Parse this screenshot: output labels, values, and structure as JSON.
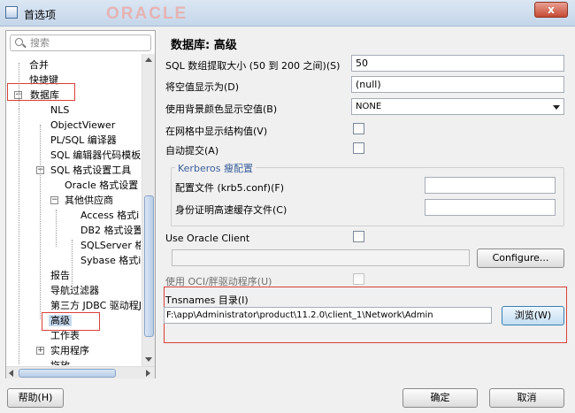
{
  "window": {
    "title": "首选项",
    "watermark": "ORACLE",
    "close_label": "x"
  },
  "search": {
    "placeholder": "搜索"
  },
  "tree": [
    {
      "label": "合并",
      "level": 1,
      "toggle": ""
    },
    {
      "label": "快捷键",
      "level": 1,
      "toggle": ""
    },
    {
      "label": "数据库",
      "level": 0,
      "toggle": "−"
    },
    {
      "label": "NLS",
      "level": 2,
      "toggle": ""
    },
    {
      "label": "ObjectViewer",
      "level": 2,
      "toggle": ""
    },
    {
      "label": "PL/SQL 编译器",
      "level": 2,
      "toggle": ""
    },
    {
      "label": "SQL 编辑器代码模板",
      "level": 2,
      "toggle": ""
    },
    {
      "label": "SQL 格式设置工具",
      "level": 2,
      "toggle": "−"
    },
    {
      "label": "Oracle 格式设置",
      "level": 3,
      "toggle": ""
    },
    {
      "label": "其他供应商",
      "level": 3,
      "toggle": "−"
    },
    {
      "label": "Access 格式i",
      "level": 4,
      "toggle": ""
    },
    {
      "label": "DB2 格式设置",
      "level": 4,
      "toggle": ""
    },
    {
      "label": "SQLServer 格",
      "level": 4,
      "toggle": ""
    },
    {
      "label": "Sybase 格式i",
      "level": 4,
      "toggle": ""
    },
    {
      "label": "报告",
      "level": 2,
      "toggle": ""
    },
    {
      "label": "导航过滤器",
      "level": 2,
      "toggle": ""
    },
    {
      "label": "第三方 JDBC 驱动程J",
      "level": 2,
      "toggle": ""
    },
    {
      "label": "高级",
      "level": 2,
      "toggle": "",
      "selected": true
    },
    {
      "label": "工作表",
      "level": 2,
      "toggle": ""
    },
    {
      "label": "实用程序",
      "level": 2,
      "toggle": "+"
    },
    {
      "label": "拖放",
      "level": 2,
      "toggle": ""
    }
  ],
  "main": {
    "title": "数据库: 高级",
    "fetch_size_label": "SQL 数组提取大小 (50 到 200 之间)(S)",
    "fetch_size_value": "50",
    "null_display_label": "将空值显示为(D)",
    "null_display_value": "(null)",
    "bg_color_label": "使用背景颜色显示空值(B)",
    "bg_color_value": "NONE",
    "grid_struct_label": "在网格中显示结构值(V)",
    "autocommit_label": "自动提交(A)",
    "kerberos_legend": "Kerberos 瘦配置",
    "config_file_label": "配置文件 (krb5.conf)(F)",
    "config_file_value": "",
    "cred_cache_label": "身份证明高速缓存文件(C)",
    "cred_cache_value": "",
    "use_oracle_client_label": "Use Oracle Client",
    "configure_button": "Configure...",
    "oci_label": "使用 OCI/胖驱动程序(U)",
    "tnsnames_label": "Tnsnames 目录(I)",
    "tnsnames_value": "F:\\app\\Administrator\\product\\11.2.0\\client_1\\Network\\Admin",
    "browse_button": "浏览(W)"
  },
  "footer": {
    "help_button": "帮助(H)",
    "ok_button": "确定",
    "cancel_button": "取消"
  },
  "colors": {
    "highlight_box": "#d9403a",
    "selection": "#c7d9f0"
  }
}
